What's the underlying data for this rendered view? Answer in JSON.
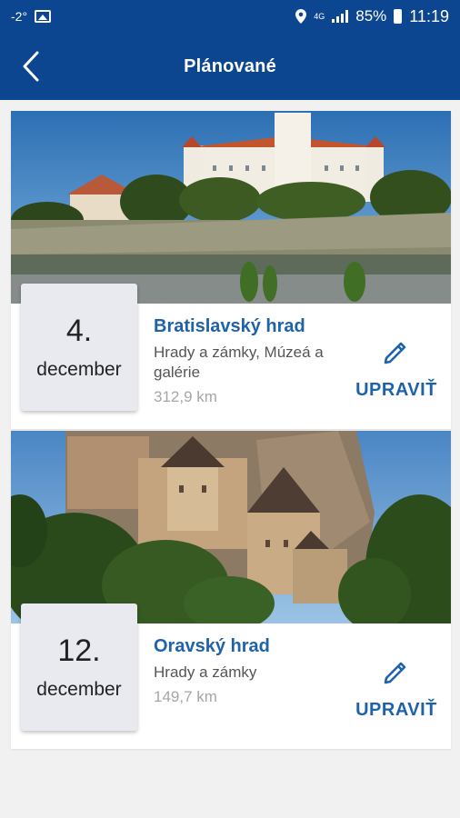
{
  "status_bar": {
    "temperature": "-2°",
    "network": "4G",
    "battery": "85%",
    "time": "11:19"
  },
  "app_bar": {
    "title": "Plánované",
    "back_icon": "chevron-left-icon"
  },
  "colors": {
    "primary": "#0d4690",
    "accent": "#1f62a9",
    "date_box": "#e9eaf0"
  },
  "trips": [
    {
      "day": "4.",
      "month": "december",
      "name": "Bratislavský hrad",
      "category": "Hrady a zámky, Múzeá a galérie",
      "distance": "312,9 km",
      "edit_label": "UPRAVIŤ",
      "edit_icon": "pencil-icon"
    },
    {
      "day": "12.",
      "month": "december",
      "name": "Oravský hrad",
      "category": "Hrady a zámky",
      "distance": "149,7 km",
      "edit_label": "UPRAVIŤ",
      "edit_icon": "pencil-icon"
    }
  ]
}
